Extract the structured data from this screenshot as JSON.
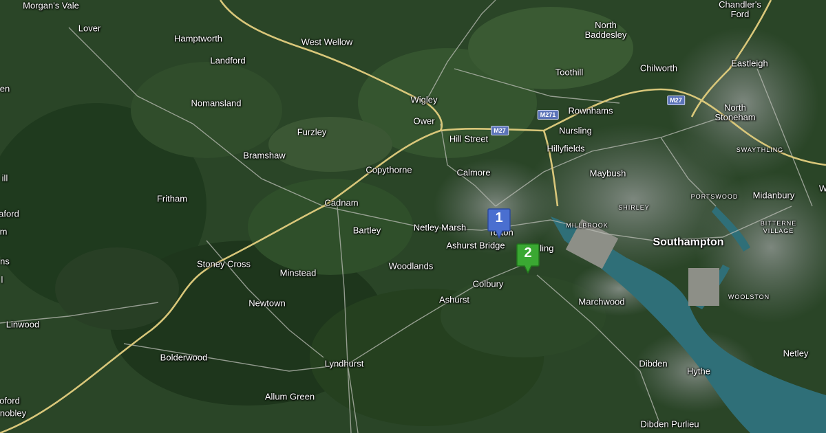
{
  "map": {
    "labels": {
      "morgans_vale": "Morgan's Vale",
      "lover": "Lover",
      "hamptworth": "Hamptworth",
      "landford": "Landford",
      "west_wellow": "West Wellow",
      "chandlers_ford": "Chandler's\nFord",
      "north_baddesley": "North\nBaddesley",
      "toothill": "Toothill",
      "chilworth": "Chilworth",
      "eastleigh": "Eastleigh",
      "nomansland": "Nomansland",
      "wigley": "Wigley",
      "rownhams": "Rownhams",
      "north_stoneham": "North\nStoneham",
      "furzley": "Furzley",
      "ower": "Ower",
      "nursling": "Nursling",
      "hill_street": "Hill Street",
      "hillyfields": "Hillyfields",
      "swaythling": "SWAYTHLING",
      "bramshaw": "Bramshaw",
      "copythorne": "Copythorne",
      "calmore": "Calmore",
      "maybush": "Maybush",
      "fritham": "Fritham",
      "cadnam": "Cadnam",
      "portswood": "PORTSWOOD",
      "midanbury": "Midanbury",
      "shirley": "SHIRLEY",
      "bartley": "Bartley",
      "netley_marsh": "Netley Marsh",
      "totton": "Totton",
      "millbrook": "MILLBROOK",
      "bitterne_village": "BITTERNE\nVILLAGE",
      "southampton": "Southampton",
      "ashurst_bridge": "Ashurst Bridge",
      "eling": "Eling",
      "stoney_cross": "Stoney Cross",
      "woodlands": "Woodlands",
      "minstead": "Minstead",
      "colbury": "Colbury",
      "newtown": "Newtown",
      "ashurst": "Ashurst",
      "marchwood": "Marchwood",
      "woolston": "WOOLSTON",
      "linwood": "Linwood",
      "bolderwood": "Bolderwood",
      "lyndhurst": "Lyndhurst",
      "dibden": "Dibden",
      "hythe": "Hythe",
      "netley": "Netley",
      "allum_green": "Allum Green",
      "dibden_purlieu": "Dibden Purlieu",
      "edge_en": "en",
      "edge_ill": "ill",
      "edge_aford": "aford",
      "edge_m": "m",
      "edge_ns": "ns",
      "edge_l": "l",
      "edge_oford": "oford",
      "edge_nobley": "nobley",
      "edge_w": "W"
    },
    "road_shields": {
      "m271": "M271",
      "m27_west": "M27",
      "m27_east": "M27"
    },
    "markers": [
      {
        "label": "1",
        "color": "#4a6fd0"
      },
      {
        "label": "2",
        "color": "#3aa832"
      }
    ],
    "colors": {
      "forest": "#2a4a28",
      "water": "#2f6f78",
      "motorway": "#d9c77a",
      "urban": "#6f7a74"
    }
  }
}
